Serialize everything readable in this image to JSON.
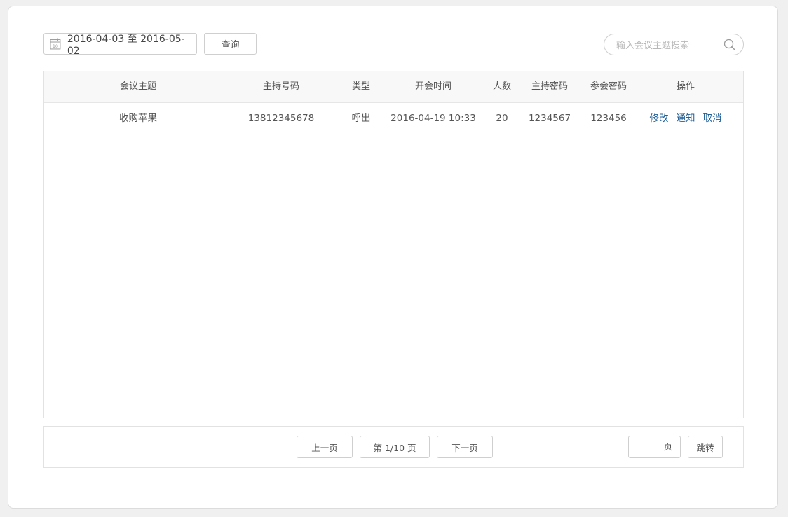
{
  "filter": {
    "date_range": "2016-04-03 至 2016-05-02",
    "query_label": "查询",
    "search_placeholder": "输入会议主题搜索"
  },
  "table": {
    "headers": [
      "会议主题",
      "主持号码",
      "类型",
      "开会时间",
      "人数",
      "主持密码",
      "参会密码",
      "操作"
    ],
    "rows": [
      {
        "topic": "收购苹果",
        "host_number": "13812345678",
        "type": "呼出",
        "start_time": "2016-04-19 10:33",
        "count": "20",
        "host_password": "1234567",
        "join_password": "123456",
        "actions": [
          "修改",
          "通知",
          "取消"
        ]
      }
    ]
  },
  "pagination": {
    "prev_label": "上一页",
    "page_info": "第 1/10 页",
    "next_label": "下一页",
    "page_input_value": "",
    "page_unit": "页",
    "jump_label": "跳转"
  },
  "colors": {
    "link": "#1f5f99",
    "count": "#3a9a2a",
    "header_bg": "#f8f8f8"
  },
  "icons": {
    "date": "calendar-icon",
    "search": "search-icon"
  }
}
